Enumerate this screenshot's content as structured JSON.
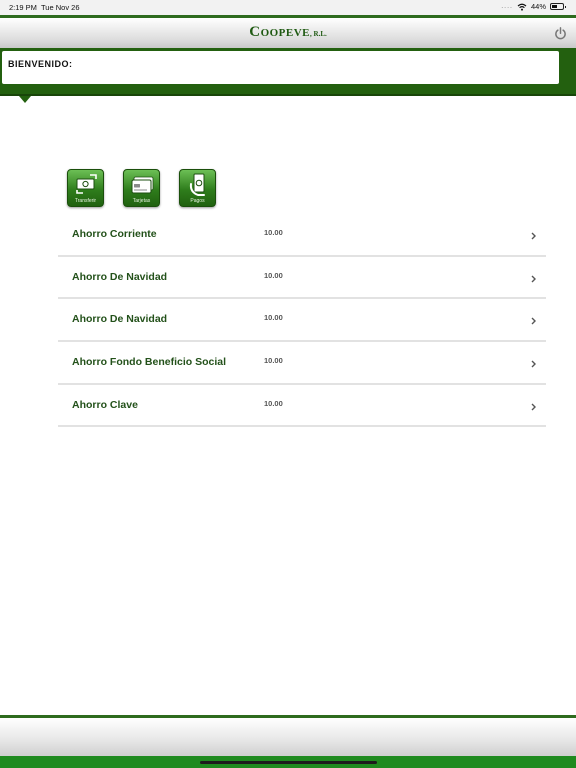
{
  "status_bar": {
    "time": "2:19 PM",
    "date": "Tue Nov 26",
    "signal_dots": "....",
    "battery_text": "44%",
    "battery_level": 0.44
  },
  "header": {
    "brand_name": "Coopeve",
    "brand_suffix": ", R.L."
  },
  "banner": {
    "welcome": "BIENVENIDO:"
  },
  "actions": [
    {
      "label": "Transferir",
      "icon": "transfer-icon"
    },
    {
      "label": "Tarjetas",
      "icon": "card-icon"
    },
    {
      "label": "Pagos",
      "icon": "payment-icon"
    }
  ],
  "accounts": [
    {
      "name": "Ahorro Corriente",
      "amount": "10.00"
    },
    {
      "name": "Ahorro De Navidad",
      "amount": "10.00"
    },
    {
      "name": "Ahorro De Navidad",
      "amount": "10.00"
    },
    {
      "name": "Ahorro Fondo Beneficio Social",
      "amount": "10.00"
    },
    {
      "name": "Ahorro Clave",
      "amount": "10.00"
    }
  ],
  "colors": {
    "brand_green": "#23600f",
    "text_green": "#23511a"
  }
}
